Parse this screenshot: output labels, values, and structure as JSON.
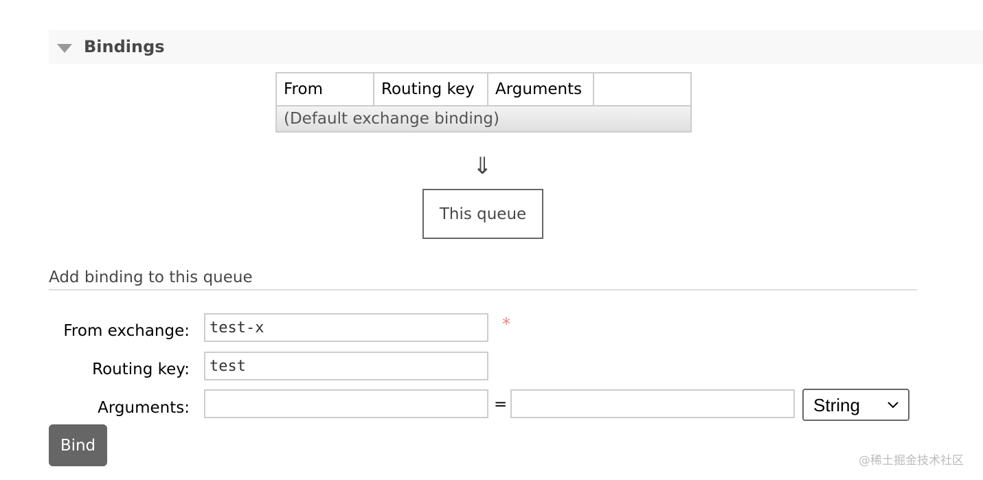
{
  "section": {
    "title": "Bindings",
    "icon": "triangle-down-icon"
  },
  "bindings_table": {
    "headers": [
      "From",
      "Routing key",
      "Arguments",
      ""
    ],
    "rows": [
      [
        "(Default exchange binding)"
      ]
    ]
  },
  "flow": {
    "arrow": "⇓",
    "queue_label": "This queue"
  },
  "add_binding": {
    "title": "Add binding to this queue",
    "from_exchange": {
      "label": "From exchange:",
      "value": "test-x",
      "required": "*"
    },
    "routing_key": {
      "label": "Routing key:",
      "value": "test"
    },
    "arguments": {
      "label": "Arguments:",
      "key_value": "",
      "equals": "=",
      "value": "",
      "type": "String"
    },
    "bind_label": "Bind"
  },
  "watermark": "@稀土掘金技术社区"
}
